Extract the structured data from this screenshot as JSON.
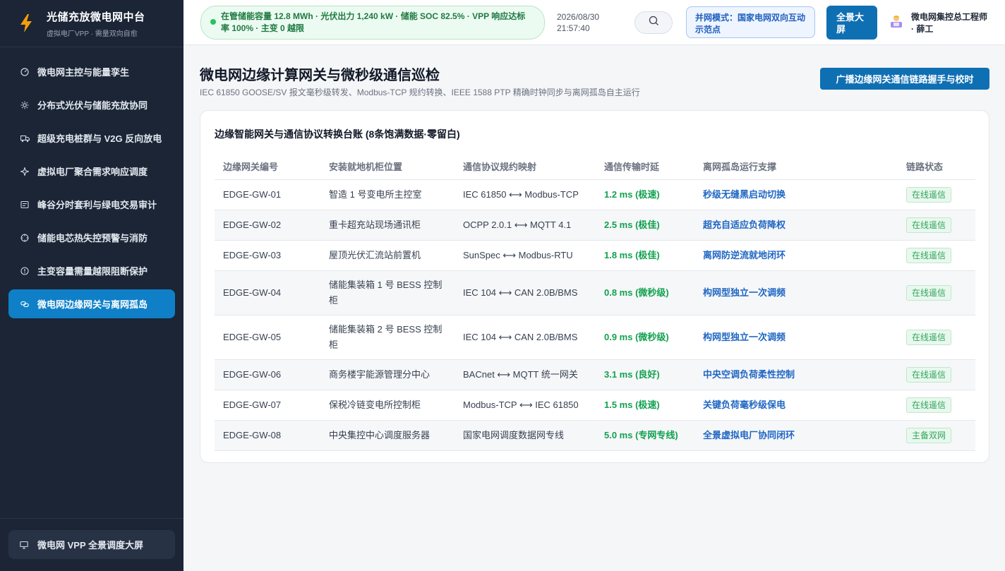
{
  "sidebar": {
    "brand_title": "光储充放微电网中台",
    "brand_sub": "虚拟电厂VPP · 需量双向自愈",
    "items": [
      {
        "label": "微电网主控与能量孪生",
        "icon": "gauge-icon"
      },
      {
        "label": "分布式光伏与储能充放协同",
        "icon": "sun-icon"
      },
      {
        "label": "超级充电桩群与 V2G 反向放电",
        "icon": "truck-icon"
      },
      {
        "label": "虚拟电厂聚合需求响应调度",
        "icon": "sparkle-icon"
      },
      {
        "label": "峰谷分时套利与绿电交易审计",
        "icon": "receipt-icon"
      },
      {
        "label": "储能电芯热失控预警与消防",
        "icon": "crosshair-icon"
      },
      {
        "label": "主变容量需量越限阻断保护",
        "icon": "alert-circle-icon"
      },
      {
        "label": "微电网边缘网关与离网孤岛",
        "icon": "link-icon"
      }
    ],
    "active_index": 7,
    "bottom_label": "微电网 VPP 全景调度大屏"
  },
  "header": {
    "status_text": "在管储能容量 12.8 MWh · 光伏出力 1,240 kW · 储能 SOC 82.5% · VPP 响应达标率 100% · 主变 0 越限",
    "date": "2026/08/30",
    "time": "21:57:40",
    "grid_mode": "并网模式：国家电网双向互动示范点",
    "panorama_label": "全景大屏",
    "user_name": "微电网集控总工程师 · 薛工"
  },
  "page": {
    "title": "微电网边缘计算网关与微秒级通信巡检",
    "subtitle": "IEC 61850 GOOSE/SV 报文毫秒级转发、Modbus-TCP 规约转换、IEEE 1588 PTP 精确时钟同步与离网孤岛自主运行",
    "broadcast_label": "广播边缘网关通信链路握手与校时"
  },
  "table": {
    "title": "边缘智能网关与通信协议转换台账 (8条饱满数据·零留白)",
    "headers": [
      "边缘网关编号",
      "安装就地机柜位置",
      "通信协议规约映射",
      "通信传输时延",
      "离网孤岛运行支撑",
      "链路状态"
    ],
    "rows": [
      {
        "id": "EDGE-GW-01",
        "location": "智造 1 号变电所主控室",
        "protocol": "IEC 61850 ⟷ Modbus-TCP",
        "latency": "1.2 ms (极速)",
        "support": "秒级无缝黑启动切换",
        "status": "在线遥信"
      },
      {
        "id": "EDGE-GW-02",
        "location": "重卡超充站现场通讯柜",
        "protocol": "OCPP 2.0.1 ⟷ MQTT 4.1",
        "latency": "2.5 ms (极佳)",
        "support": "超充自适应负荷降权",
        "status": "在线遥信"
      },
      {
        "id": "EDGE-GW-03",
        "location": "屋顶光伏汇流站前置机",
        "protocol": "SunSpec ⟷ Modbus-RTU",
        "latency": "1.8 ms (极佳)",
        "support": "离网防逆流就地闭环",
        "status": "在线遥信"
      },
      {
        "id": "EDGE-GW-04",
        "location": "储能集装箱 1 号 BESS 控制柜",
        "protocol": "IEC 104 ⟷ CAN 2.0B/BMS",
        "latency": "0.8 ms (微秒级)",
        "support": "构网型独立一次调频",
        "status": "在线遥信"
      },
      {
        "id": "EDGE-GW-05",
        "location": "储能集装箱 2 号 BESS 控制柜",
        "protocol": "IEC 104 ⟷ CAN 2.0B/BMS",
        "latency": "0.9 ms (微秒级)",
        "support": "构网型独立一次调频",
        "status": "在线遥信"
      },
      {
        "id": "EDGE-GW-06",
        "location": "商务楼宇能源管理分中心",
        "protocol": "BACnet ⟷ MQTT 统一网关",
        "latency": "3.1 ms (良好)",
        "support": "中央空调负荷柔性控制",
        "status": "在线遥信"
      },
      {
        "id": "EDGE-GW-07",
        "location": "保税冷链变电所控制柜",
        "protocol": "Modbus-TCP ⟷ IEC 61850",
        "latency": "1.5 ms (极速)",
        "support": "关键负荷毫秒级保电",
        "status": "在线遥信"
      },
      {
        "id": "EDGE-GW-08",
        "location": "中央集控中心调度服务器",
        "protocol": "国家电网调度数据网专线",
        "latency": "5.0 ms (专网专线)",
        "support": "全景虚拟电厂协同闭环",
        "status": "主备双网"
      }
    ]
  },
  "colors": {
    "sidebar_bg": "#1b2536",
    "accent": "#0f6fb3",
    "active_nav": "#0f80c8",
    "latency_green": "#12a150",
    "support_blue": "#1f66c3"
  }
}
